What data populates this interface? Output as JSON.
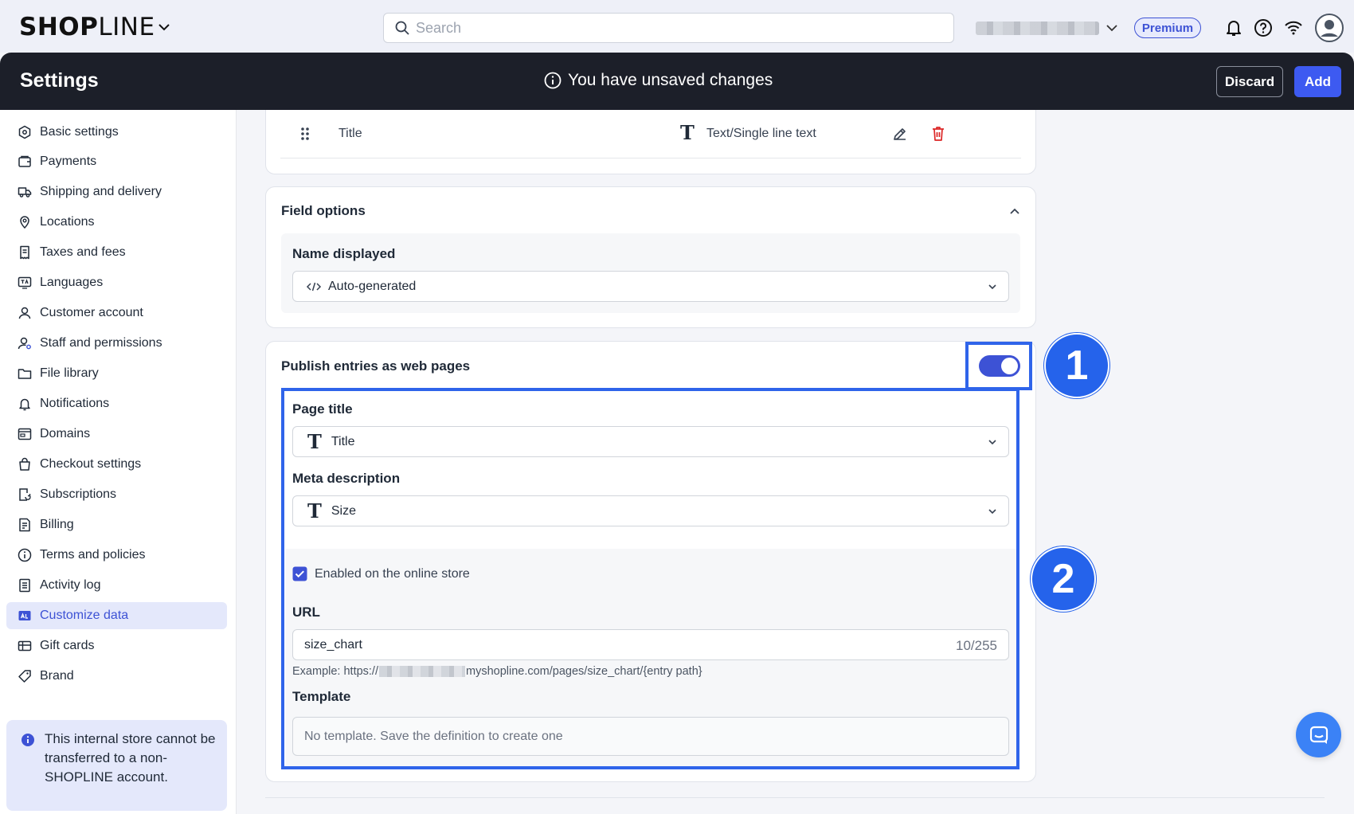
{
  "topbar": {
    "logo_bold_1": "SHOP",
    "logo_light": "LINE",
    "search_placeholder": "Search",
    "plan_badge": "Premium"
  },
  "header": {
    "title": "Settings",
    "unsaved_text": "You have unsaved changes",
    "discard_label": "Discard",
    "add_label": "Add"
  },
  "sidebar": {
    "items": [
      {
        "label": "Basic settings",
        "icon": "hexagon-icon"
      },
      {
        "label": "Payments",
        "icon": "wallet-icon"
      },
      {
        "label": "Shipping and delivery",
        "icon": "truck-icon"
      },
      {
        "label": "Locations",
        "icon": "map-pin-icon"
      },
      {
        "label": "Taxes and fees",
        "icon": "receipt-icon"
      },
      {
        "label": "Languages",
        "icon": "language-icon"
      },
      {
        "label": "Customer account",
        "icon": "user-icon"
      },
      {
        "label": "Staff and permissions",
        "icon": "user-gear-icon"
      },
      {
        "label": "File library",
        "icon": "folder-icon"
      },
      {
        "label": "Notifications",
        "icon": "bell-icon"
      },
      {
        "label": "Domains",
        "icon": "browser-icon"
      },
      {
        "label": "Checkout settings",
        "icon": "bag-icon"
      },
      {
        "label": "Subscriptions",
        "icon": "subscription-icon"
      },
      {
        "label": "Billing",
        "icon": "bill-icon"
      },
      {
        "label": "Terms and policies",
        "icon": "info-icon"
      },
      {
        "label": "Activity log",
        "icon": "log-icon"
      },
      {
        "label": "Customize data",
        "icon": "data-icon"
      },
      {
        "label": "Gift cards",
        "icon": "gift-card-icon"
      },
      {
        "label": "Brand",
        "icon": "tag-icon"
      }
    ],
    "active_index": 16,
    "notice": "This internal store cannot be transferred to a non-SHOPLINE account."
  },
  "field_row": {
    "name": "Title",
    "type": "Text/Single line text"
  },
  "field_options": {
    "heading": "Field options",
    "name_displayed_label": "Name displayed",
    "name_displayed_value": "Auto-generated"
  },
  "publish": {
    "heading": "Publish entries as web pages",
    "enabled": true,
    "page_title_label": "Page title",
    "page_title_value": "Title",
    "meta_description_label": "Meta description",
    "meta_description_value": "Size",
    "online_store_checkbox_label": "Enabled on the online store",
    "online_store_checked": true,
    "url_label": "URL",
    "url_value": "size_chart",
    "url_counter": "10/255",
    "example_prefix": "Example: https://",
    "example_suffix": "myshopline.com/pages/size_chart/{entry path}",
    "template_label": "Template",
    "template_placeholder": "No template. Save the definition to create one"
  },
  "annotations": {
    "badge_1": "1",
    "badge_2": "2"
  },
  "colors": {
    "accent": "#3d52d5",
    "primary_button": "#3d5af1",
    "highlight": "#2f64ea",
    "header_bg": "#1c1f29",
    "delete_red": "#dc2626"
  }
}
